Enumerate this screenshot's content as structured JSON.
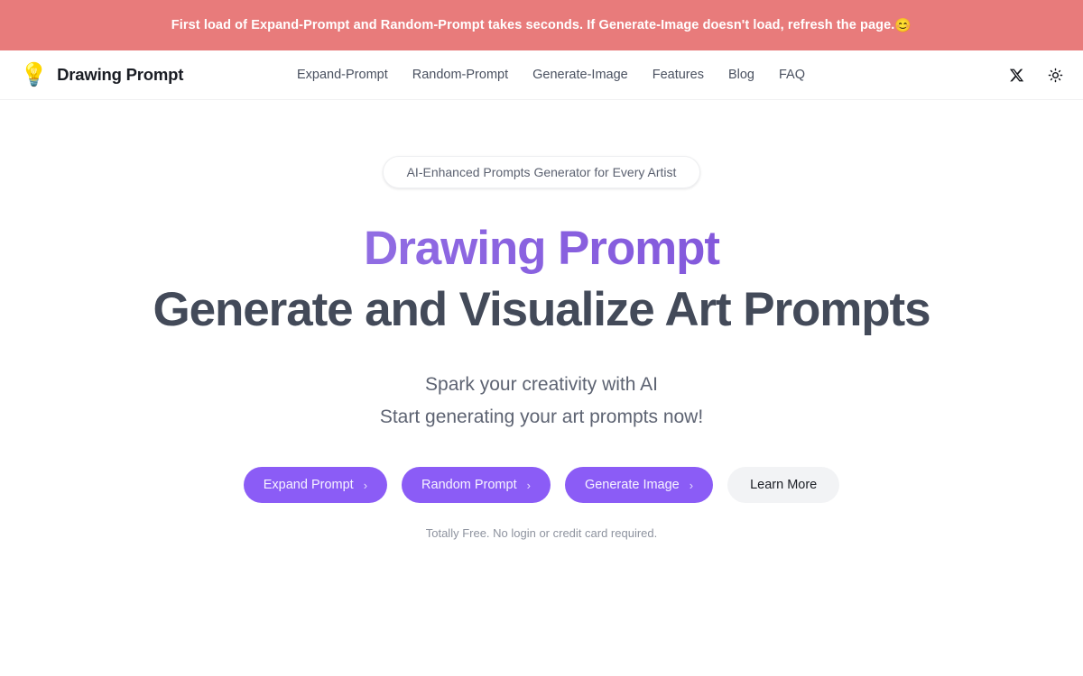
{
  "announcement": {
    "text": "First load of Expand-Prompt and Random-Prompt takes seconds. If Generate-Image doesn't load, refresh the page.",
    "emoji": "😊",
    "background_color": "#e87b7b",
    "text_color": "#ffffff"
  },
  "header": {
    "logo_icon": "lightbulb-icon",
    "logo_emoji": "💡",
    "brand_name": "Drawing Prompt",
    "nav": [
      {
        "label": "Expand-Prompt"
      },
      {
        "label": "Random-Prompt"
      },
      {
        "label": "Generate-Image"
      },
      {
        "label": "Features"
      },
      {
        "label": "Blog"
      },
      {
        "label": "FAQ"
      }
    ],
    "actions": [
      {
        "name": "x-twitter-icon",
        "label": "X"
      },
      {
        "name": "theme-toggle-sun-icon",
        "label": "Sun"
      }
    ]
  },
  "hero": {
    "badge": "AI-Enhanced Prompts Generator for Every Artist",
    "title_gradient": "Drawing Prompt",
    "title_plain": "Generate and Visualize Art Prompts",
    "subtitle_line1": "Spark your creativity with AI",
    "subtitle_line2": "Start generating your art prompts now!",
    "buttons": [
      {
        "label": "Expand Prompt",
        "chevron": "›",
        "style": "primary"
      },
      {
        "label": "Random Prompt",
        "chevron": "›",
        "style": "primary"
      },
      {
        "label": "Generate Image",
        "chevron": "›",
        "style": "primary"
      },
      {
        "label": "Learn More",
        "chevron": "",
        "style": "secondary"
      }
    ],
    "note": "Totally Free. No login or credit card required."
  },
  "colors": {
    "accent_purple": "#8b5cf6",
    "gradient_start": "#9b7de8",
    "gradient_end": "#7d4fd8",
    "heading_slate": "#434a59",
    "banner_red": "#e87b7b"
  }
}
